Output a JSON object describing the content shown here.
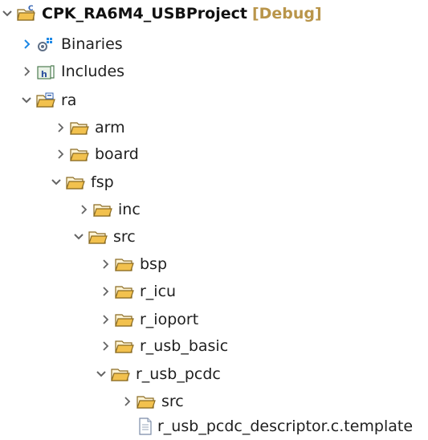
{
  "project": {
    "name": "CPK_RA6M4_USBProject",
    "decoration": "[Debug]"
  },
  "tree": {
    "binaries": "Binaries",
    "includes": "Includes",
    "ra": "ra",
    "arm": "arm",
    "board": "board",
    "fsp": "fsp",
    "inc": "inc",
    "src": "src",
    "bsp": "bsp",
    "r_icu": "r_icu",
    "r_ioport": "r_ioport",
    "r_usb_basic": "r_usb_basic",
    "r_usb_pcdc": "r_usb_pcdc",
    "pcdc_src": "src",
    "template_file": "r_usb_pcdc_descriptor.c.template"
  },
  "colors": {
    "folder": "#d9a441",
    "chevron": "#646464",
    "binaries_chevron": "#1e88e5",
    "project_decoration": "#b9954a"
  },
  "icons": {
    "project": "c-project-icon",
    "binaries": "binaries-icon",
    "includes": "includes-icon",
    "folder": "folder-icon",
    "file": "file-icon"
  }
}
